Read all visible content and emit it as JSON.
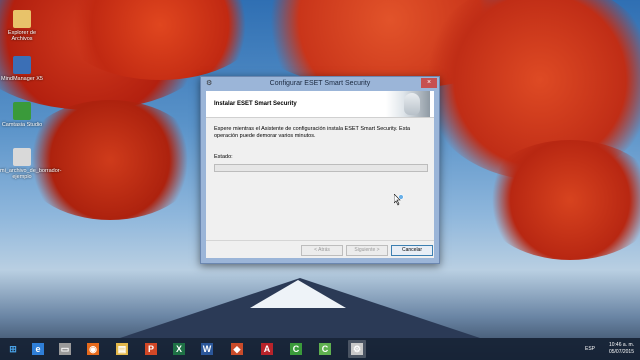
{
  "desktop": {
    "icons": [
      {
        "label": "Explorer de Archivos"
      },
      {
        "label": "MindManager X5"
      },
      {
        "label": "Camtasia Studio"
      },
      {
        "label": "mi_archivo_de_borrador-ejemplo"
      }
    ]
  },
  "dialog": {
    "title": "Configurar ESET Smart Security",
    "close_glyph": "×",
    "header_title": "Instalar ESET Smart Security",
    "description": "Espere mientras el Asistente de configuración instala ESET Smart Security. Esta operación puede demorar varios minutos.",
    "status_label": "Estado:",
    "progress": 0,
    "buttons": {
      "back": "< Atrás",
      "next": "Siguiente >",
      "cancel": "Cancelar"
    }
  },
  "taskbar": {
    "items": [
      {
        "icon": "windows-start-icon"
      },
      {
        "icon": "ie-icon"
      },
      {
        "icon": "folder-icon"
      },
      {
        "icon": "firefox-icon"
      },
      {
        "icon": "explorer-icon"
      },
      {
        "icon": "powerpoint-icon"
      },
      {
        "icon": "excel-icon"
      },
      {
        "icon": "word-icon"
      },
      {
        "icon": "app-icon"
      },
      {
        "icon": "acrobat-icon"
      },
      {
        "icon": "camtasia-icon"
      },
      {
        "icon": "camtasia-recorder-icon"
      },
      {
        "icon": "eset-setup-icon"
      }
    ],
    "language": "ESP",
    "time": "10:46 a. m.",
    "date": "05/07/2015"
  }
}
